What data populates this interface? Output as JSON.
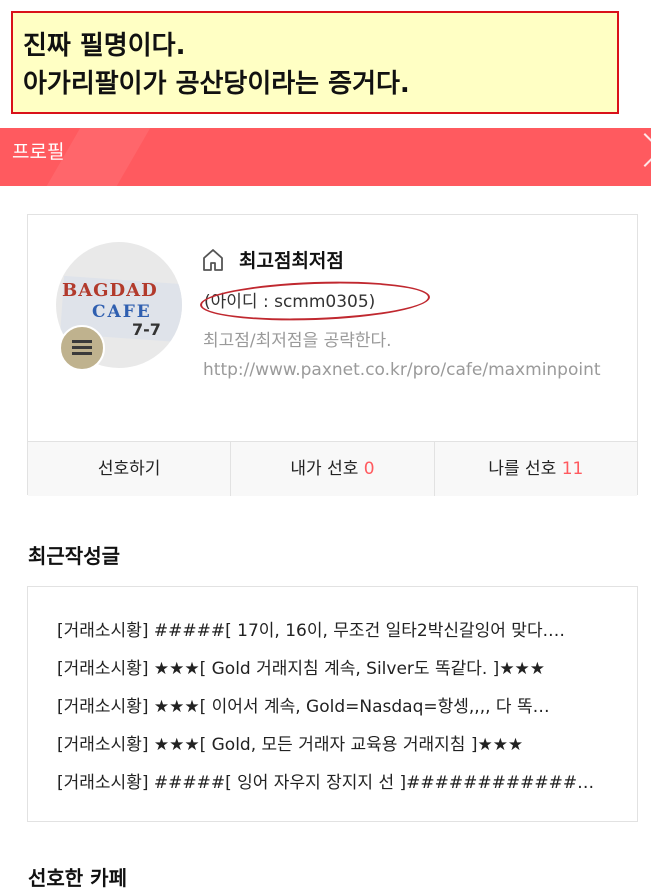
{
  "annotation": {
    "line1": "진짜 필명이다.",
    "line2": "아가리팔이가 공산당이라는 증거다."
  },
  "header": {
    "title": "프로필"
  },
  "profile": {
    "avatar_text": [
      "BAGDAD",
      "CAFE",
      "7-7"
    ],
    "name": "최고점최저점",
    "id_text": "(아이디 : scmm0305)",
    "description": "최고점/최저점을 공략한다. http://www.paxnet.co.kr/pro/cafe/maxminpoint"
  },
  "card_tabs": {
    "favorite": "선호하기",
    "my_favorites_label": "내가 선호 ",
    "my_favorites_count": "0",
    "favorites_me_label": "나를 선호 ",
    "favorites_me_count": "11"
  },
  "recent_posts": {
    "title": "최근작성글",
    "items": [
      "[거래소시황] #####[ 17이, 16이, 무조건 일타2박신갈잉어 맞다.…",
      "[거래소시황] ★★★[ Gold 거래지침 계속, Silver도 똑같다. ]★★★",
      "[거래소시황] ★★★[ 이어서 계속, Gold=Nasdaq=항셍,,,, 다 똑…",
      "[거래소시황] ★★★[ Gold, 모든 거래자 교육용 거래지침 ]★★★",
      "[거래소시황] #####[ 잉어 자우지 장지지 선 ]#############…"
    ]
  },
  "next_section": {
    "title": "선호한 카페"
  },
  "colors": {
    "accent": "#ff5a5f",
    "annotation_border": "#d9111a",
    "annotation_bg": "#ffffc4"
  },
  "icons": {
    "home": "home-icon",
    "menu": "menu-icon",
    "close": "chevron-right-icon"
  }
}
